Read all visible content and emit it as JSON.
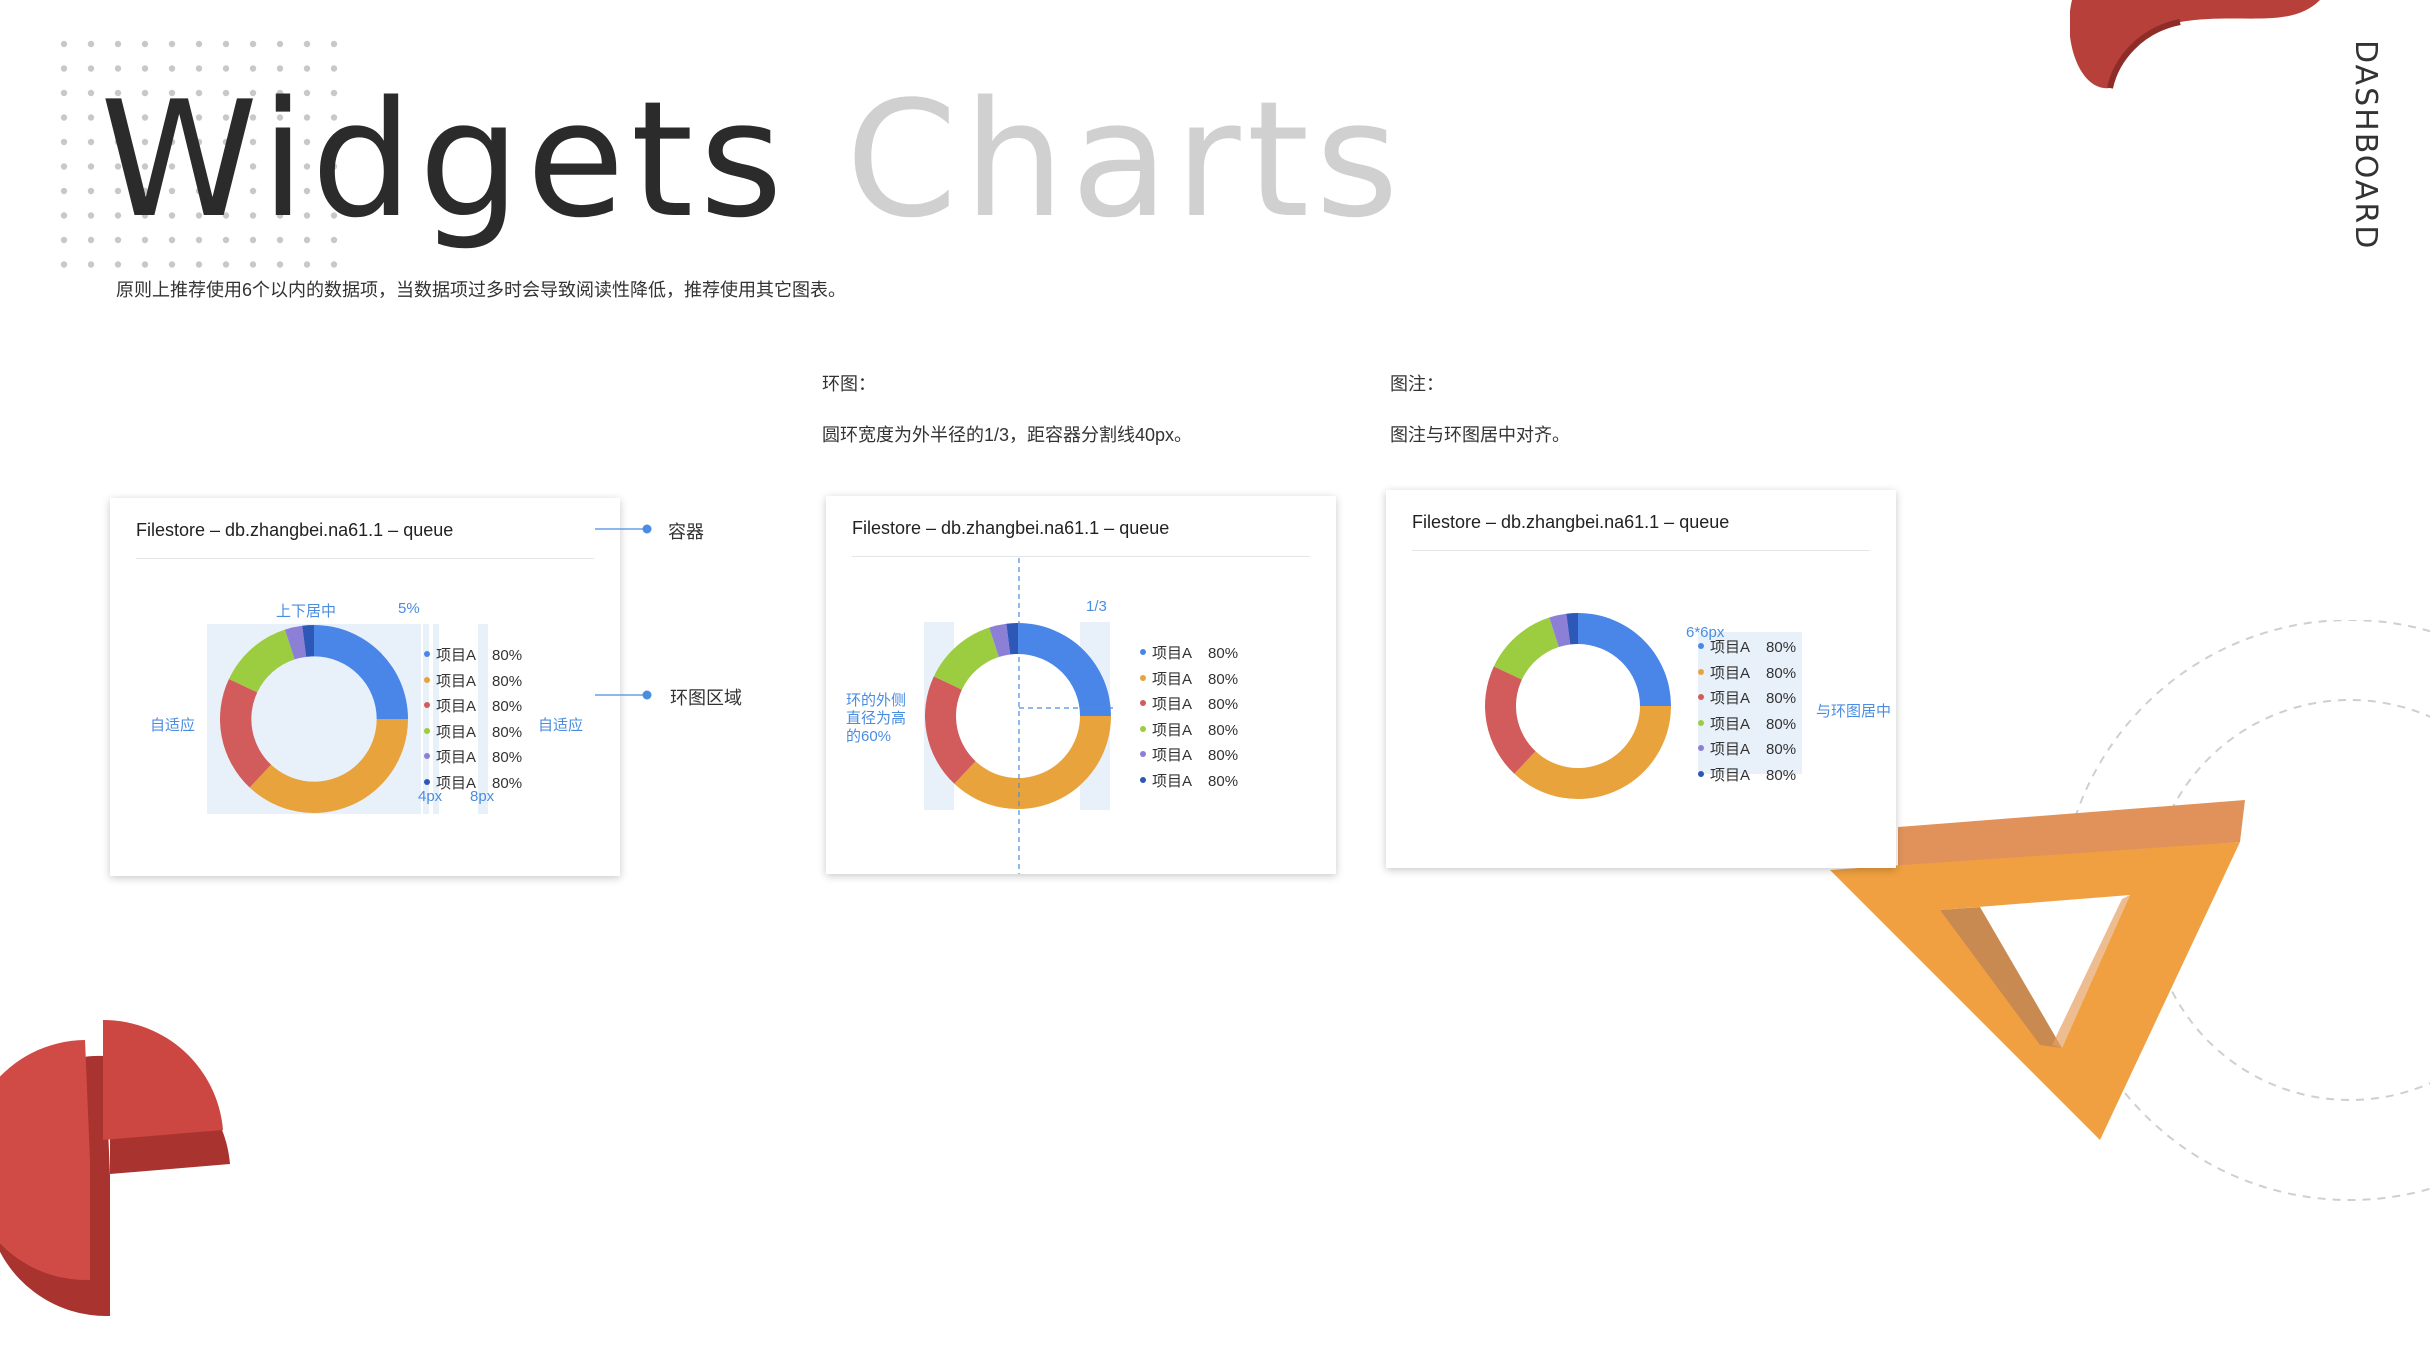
{
  "header": {
    "title_part1": "Widgets",
    "title_part2": "Charts",
    "subtitle": "原则上推荐使用6个以内的数据项，当数据项过多时会导致阅读性降低，推荐使用其它图表。",
    "vertical_tag": "DASHBOARD"
  },
  "notes": {
    "ring_title": "环图：",
    "ring_desc": "圆环宽度为外半径的1/3，距容器分割线40px。",
    "legend_title": "图注：",
    "legend_desc": "图注与环图居中对齐。"
  },
  "cards": [
    {
      "title": "Filestore – db.zhangbei.na61.1 – queue",
      "annotations": {
        "center": "上下居中",
        "percent": "5%",
        "adaptive_left": "自适应",
        "adaptive_right": "自适应",
        "gap_4": "4px",
        "gap_8": "8px"
      },
      "callouts": {
        "container": "容器",
        "area": "环图区域"
      }
    },
    {
      "title": "Filestore – db.zhangbei.na61.1 – queue",
      "annotations": {
        "third": "1/3",
        "diameter": "环的外侧直径为高的60%"
      }
    },
    {
      "title": "Filestore – db.zhangbei.na61.1 – queue",
      "annotations": {
        "dot_size": "6*6px",
        "center_align": "与环图居中"
      }
    }
  ],
  "legend": [
    {
      "label": "项目A",
      "value": "80%",
      "color": "#4a86e8"
    },
    {
      "label": "项目A",
      "value": "80%",
      "color": "#e8a33d"
    },
    {
      "label": "项目A",
      "value": "80%",
      "color": "#d25b5b"
    },
    {
      "label": "项目A",
      "value": "80%",
      "color": "#9ccc3f"
    },
    {
      "label": "项目A",
      "value": "80%",
      "color": "#8b7fd6"
    },
    {
      "label": "项目A",
      "value": "80%",
      "color": "#2e58b8"
    }
  ],
  "chart_data": {
    "type": "pie",
    "categories": [
      "项目A",
      "项目A",
      "项目A",
      "项目A",
      "项目A",
      "项目A"
    ],
    "values": [
      25,
      37,
      20,
      13,
      3,
      2
    ],
    "colors": [
      "#4a86e8",
      "#e8a33d",
      "#d25b5b",
      "#9ccc3f",
      "#8b7fd6",
      "#2e58b8"
    ],
    "donut": true
  },
  "colors": {
    "accent": "#4a8de0",
    "red_decor": "#c0413d",
    "orange_decor": "#f0a040"
  },
  "icons": {
    "callout_dot": "dot-icon"
  }
}
